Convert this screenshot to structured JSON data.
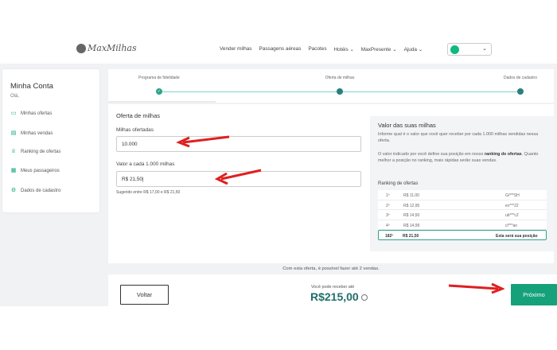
{
  "header": {
    "logo_text": "MaxMilhas",
    "nav": [
      "Vender milhas",
      "Passagens aéreas",
      "Pacotes",
      "Hotéis",
      "MaxPresente",
      "Ajuda"
    ],
    "chevron": "⌄"
  },
  "sidebar": {
    "title": "Minha Conta",
    "greeting": "Olá,",
    "items": [
      {
        "label": "Minhas ofertas",
        "icon": "ticket-icon"
      },
      {
        "label": "Minhas vendas",
        "icon": "wallet-icon"
      },
      {
        "label": "Ranking de ofertas",
        "icon": "trophy-icon"
      },
      {
        "label": "Meus passageiros",
        "icon": "calendar-icon"
      },
      {
        "label": "Dados de cadastro",
        "icon": "gear-icon"
      }
    ]
  },
  "stepper": {
    "steps": [
      "Programa de fidelidade",
      "Oferta de milhas",
      "Dados de cadastro"
    ],
    "check": "✓"
  },
  "form": {
    "title": "Oferta de milhas",
    "miles_label": "Milhas ofertadas",
    "miles_value": "10.000",
    "price_label": "Valor a cada 1.000 milhas",
    "price_value": "R$ 21,50|",
    "hint": "Sugerido entre R$ 17,00 e R$ 21,50"
  },
  "card": {
    "title": "Valor das suas milhas",
    "text1": "Informe qual é o valor que você quer receber por cada 1.000 milhas vendidas nessa oferta.",
    "text2_pre": "O valor indicado por você define sua posição em nosso ",
    "text2_bold": "ranking de ofertas",
    "text2_post": ". Quanto melhor a posição no ranking, mais rápidas serão suas vendas.",
    "ranking_title": "Ranking de ofertas",
    "rows": [
      {
        "pos": "1º",
        "price": "R$ 11,00",
        "user": "Gi***SH"
      },
      {
        "pos": "2º",
        "price": "R$ 12,95",
        "user": "ev***22"
      },
      {
        "pos": "3º",
        "price": "R$ 14,50",
        "user": "ub***c2"
      },
      {
        "pos": "4º",
        "price": "R$ 14,99",
        "user": "cl***an"
      }
    ],
    "my_row": {
      "pos": "182º",
      "price": "R$ 21,50",
      "note": "Esta será sua posição"
    }
  },
  "status_text": "Com esta oferta, é possível fazer até 2 vendas.",
  "footer": {
    "back_label": "Voltar",
    "earn_label": "Você pode receber até",
    "earn_value": "R$215,00",
    "next_label": "Próximo"
  },
  "colors": {
    "accent": "#15a17a",
    "arrow": "#e01f1f",
    "earn": "#1f6f6b"
  }
}
